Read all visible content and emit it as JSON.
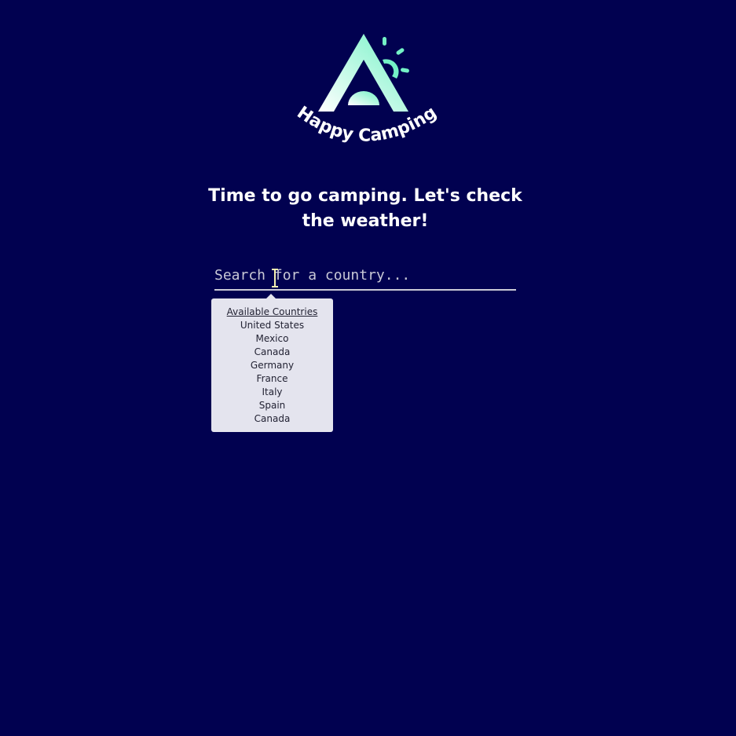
{
  "brand": {
    "logo_text": "Happy Camping",
    "colors": {
      "background": "#010150",
      "accent": "#7cf0c8"
    }
  },
  "headline": "Time to go camping. Let's check the weather!",
  "search": {
    "placeholder": "Search for a country...",
    "value": ""
  },
  "dropdown": {
    "title": "Available Countries",
    "items": [
      "United States",
      "Mexico",
      "Canada",
      "Germany",
      "France",
      "Italy",
      "Spain",
      "Canada"
    ]
  }
}
